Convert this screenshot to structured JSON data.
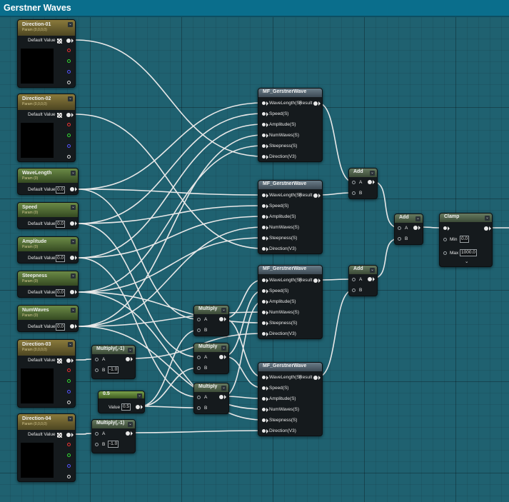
{
  "window": {
    "title": "Gerstner Waves"
  },
  "vector_params": [
    {
      "title": "Direction-01",
      "subtitle": "Param (0,0,0,0)",
      "default_label": "Default Value"
    },
    {
      "title": "Direction-02",
      "subtitle": "Param (0,0,0,0)",
      "default_label": "Default Value"
    },
    {
      "title": "Direction-03",
      "subtitle": "Param (0,0,0,0)",
      "default_label": "Default Value"
    },
    {
      "title": "Direction-04",
      "subtitle": "Param (0,0,0,0)",
      "default_label": "Default Value"
    }
  ],
  "scalar_params": [
    {
      "title": "WaveLength",
      "subtitle": "Param (0)",
      "default_label": "Default Value",
      "value": "0.0"
    },
    {
      "title": "Speed",
      "subtitle": "Param (0)",
      "default_label": "Default Value",
      "value": "0.0"
    },
    {
      "title": "Amplitude",
      "subtitle": "Param (0)",
      "default_label": "Default Value",
      "value": "0.0"
    },
    {
      "title": "Steepness",
      "subtitle": "Param (0)",
      "default_label": "Default Value",
      "value": "0.0"
    },
    {
      "title": "NumWaves",
      "subtitle": "Param (0)",
      "default_label": "Default Value",
      "value": "0.0"
    }
  ],
  "gerstner": {
    "title": "MF_GerstnerWave",
    "inputs": [
      "WaveLength(S)",
      "Speed(S)",
      "Amplitude(S)",
      "NumWaves(S)",
      "Steepness(S)",
      "Direction(V3)"
    ],
    "output": "Result"
  },
  "multiply_neg": {
    "title": "Multiply(,-1)",
    "a": "A",
    "b": "B",
    "b_value": "-1.0"
  },
  "multiply": {
    "title": "Multiply",
    "a": "A",
    "b": "B"
  },
  "add": {
    "title": "Add",
    "a": "A",
    "b": "B"
  },
  "constant": {
    "title": "0.5",
    "label": "Value",
    "value": "0.5"
  },
  "clamp": {
    "title": "Clamp",
    "min_label": "Min",
    "min_value": "0.0",
    "max_label": "Max",
    "max_value": "1000.0"
  },
  "colors": {
    "title_bar": "#0a6e8c",
    "canvas": "#1f6170",
    "wire": "#e8e8e8"
  }
}
